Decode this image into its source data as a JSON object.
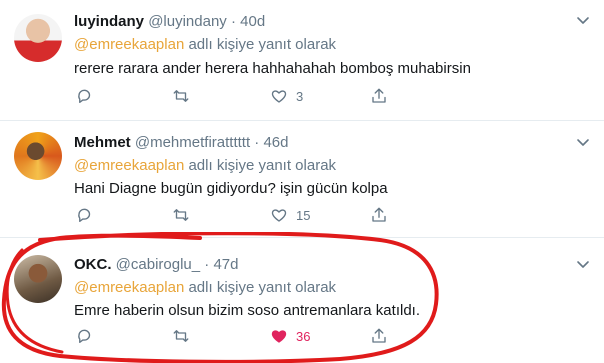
{
  "tweets": [
    {
      "name": "luyindany",
      "handle": "@luyindany",
      "dot": "·",
      "time": "40d",
      "mention": "@emreekaaplan",
      "reply_suffix": " adlı kişiye yanıt olarak",
      "text": "rerere rarara ander herera hahhahahah bomboş muhabirsin",
      "reply_count": "",
      "retweet_count": "",
      "like_count": "3",
      "liked": false
    },
    {
      "name": "Mehmet",
      "handle": "@mehmetfiratttttt",
      "dot": "·",
      "time": "46d",
      "mention": "@emreekaaplan",
      "reply_suffix": " adlı kişiye yanıt olarak",
      "text": "Hani Diagne bugün gidiyordu? işin gücün kolpa",
      "reply_count": "",
      "retweet_count": "",
      "like_count": "15",
      "liked": false
    },
    {
      "name": "OKC.",
      "handle": "@cabiroglu_",
      "dot": "·",
      "time": "47d",
      "mention": "@emreekaaplan",
      "reply_suffix": " adlı kişiye yanıt olarak",
      "text": "Emre haberin olsun bizim soso antremanlara katıldı.",
      "reply_count": "",
      "retweet_count": "",
      "like_count": "36",
      "liked": true
    }
  ],
  "icons": {
    "reply": "reply-icon",
    "retweet": "retweet-icon",
    "like": "heart-icon",
    "share": "share-icon",
    "more": "chevron-down-icon"
  },
  "colors": {
    "mention": "#e8a53a",
    "liked": "#e0245e",
    "muted": "#657786",
    "annotation": "#e01b1b"
  }
}
